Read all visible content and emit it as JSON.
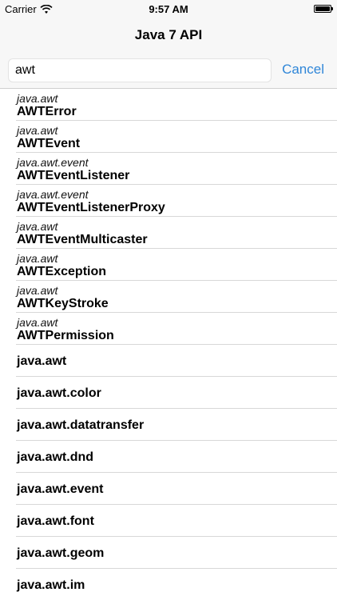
{
  "status_bar": {
    "carrier": "Carrier",
    "time": "9:57 AM",
    "wifi_icon": "wifi-icon",
    "battery_icon": "battery-icon"
  },
  "nav": {
    "title": "Java 7 API"
  },
  "search": {
    "value": "awt",
    "cancel_label": "Cancel"
  },
  "results": [
    {
      "package": "java.awt",
      "name": "AWTError"
    },
    {
      "package": "java.awt",
      "name": "AWTEvent"
    },
    {
      "package": "java.awt.event",
      "name": "AWTEventListener"
    },
    {
      "package": "java.awt.event",
      "name": "AWTEventListenerProxy"
    },
    {
      "package": "java.awt",
      "name": "AWTEventMulticaster"
    },
    {
      "package": "java.awt",
      "name": "AWTException"
    },
    {
      "package": "java.awt",
      "name": "AWTKeyStroke"
    },
    {
      "package": "java.awt",
      "name": "AWTPermission"
    },
    {
      "package": "",
      "name": "java.awt"
    },
    {
      "package": "",
      "name": "java.awt.color"
    },
    {
      "package": "",
      "name": "java.awt.datatransfer"
    },
    {
      "package": "",
      "name": "java.awt.dnd"
    },
    {
      "package": "",
      "name": "java.awt.event"
    },
    {
      "package": "",
      "name": "java.awt.font"
    },
    {
      "package": "",
      "name": "java.awt.geom"
    },
    {
      "package": "",
      "name": "java.awt.im"
    }
  ],
  "colors": {
    "accent": "#2f86d8",
    "nav_background": "#f7f7f7",
    "separator": "#d8d8d8"
  }
}
